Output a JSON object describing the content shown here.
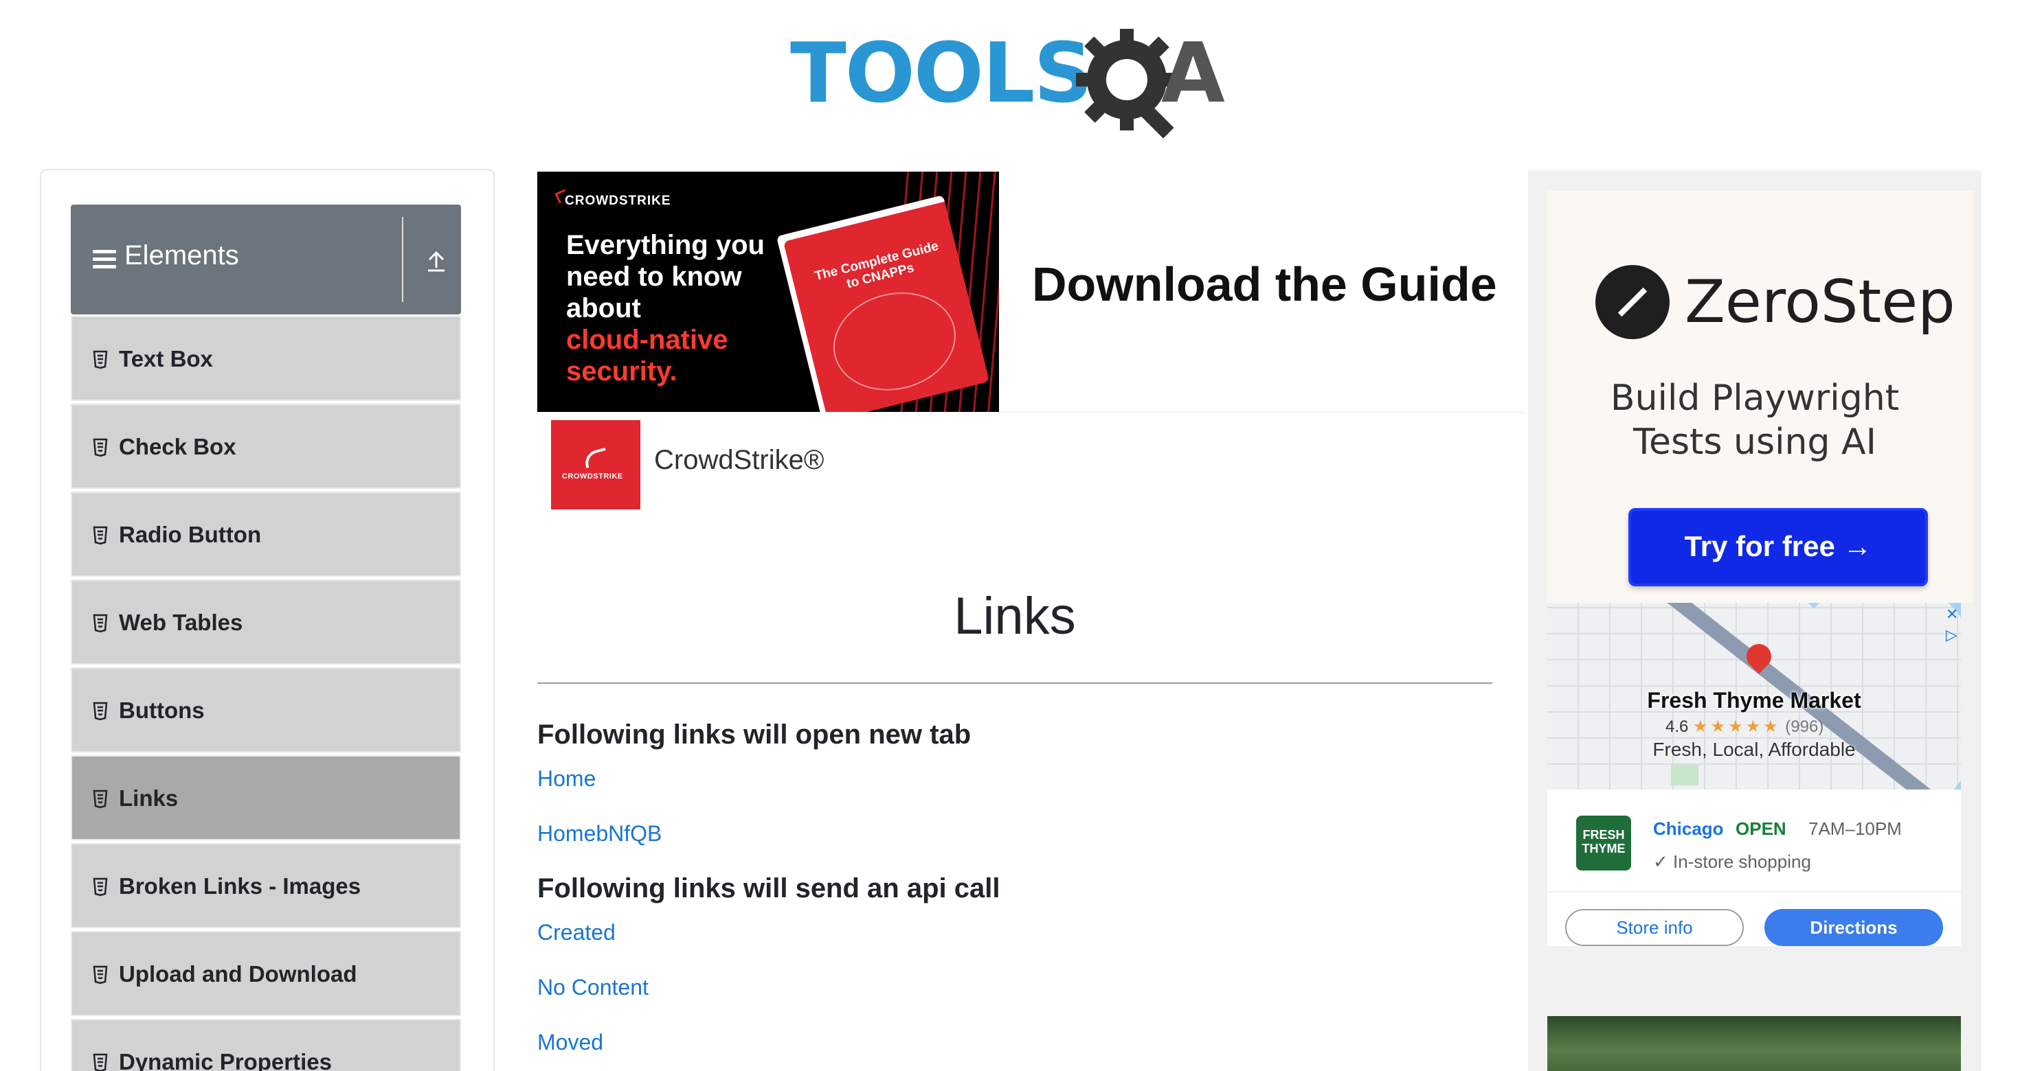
{
  "logo": {
    "left": "TOOLS",
    "right": "A"
  },
  "sidebar": {
    "group_title": "Elements",
    "items": [
      {
        "label": "Text Box",
        "active": false
      },
      {
        "label": "Check Box",
        "active": false
      },
      {
        "label": "Radio Button",
        "active": false
      },
      {
        "label": "Web Tables",
        "active": false
      },
      {
        "label": "Buttons",
        "active": false
      },
      {
        "label": "Links",
        "active": true
      },
      {
        "label": "Broken Links - Images",
        "active": false
      },
      {
        "label": "Upload and Download",
        "active": false
      },
      {
        "label": "Dynamic Properties",
        "active": false
      }
    ]
  },
  "top_ad": {
    "brand": "CROWDSTRIKE",
    "headline_white": "Everything you need to know about",
    "headline_red": "cloud-native security.",
    "book_title": "The Complete Guide to CNAPPs",
    "cta": "Download the Guide",
    "advertiser": "CrowdStrike®"
  },
  "main": {
    "title": "Links",
    "section_new_tab": "Following links will open new tab",
    "links_new_tab": [
      "Home",
      "HomebNfQB"
    ],
    "section_api": "Following links will send an api call",
    "links_api": [
      "Created",
      "No Content",
      "Moved"
    ]
  },
  "right_ad": {
    "brand": "ZeroStep",
    "tagline_line1": "Build Playwright",
    "tagline_line2": "Tests using AI",
    "cta": "Try for free →",
    "store": {
      "name": "Fresh Thyme Market",
      "rating": "4.6",
      "stars": "★★★★★",
      "reviews": "(996)",
      "description": "Fresh, Local, Affordable",
      "logo_text": "FRESH THYME",
      "city": "Chicago",
      "status": "OPEN",
      "hours": "7AM–10PM",
      "feature": "✓ In-store shopping",
      "store_info_label": "Store info",
      "directions_label": "Directions"
    }
  },
  "colors": {
    "logo_blue": "#2a97d4",
    "sidebar_header": "#6c757d",
    "menu_item": "#d2d2d2",
    "menu_item_active": "#a9a9a9",
    "link": "#1976d2",
    "crowdstrike_red": "#e0262e",
    "zerostep_button": "#1029e6"
  }
}
